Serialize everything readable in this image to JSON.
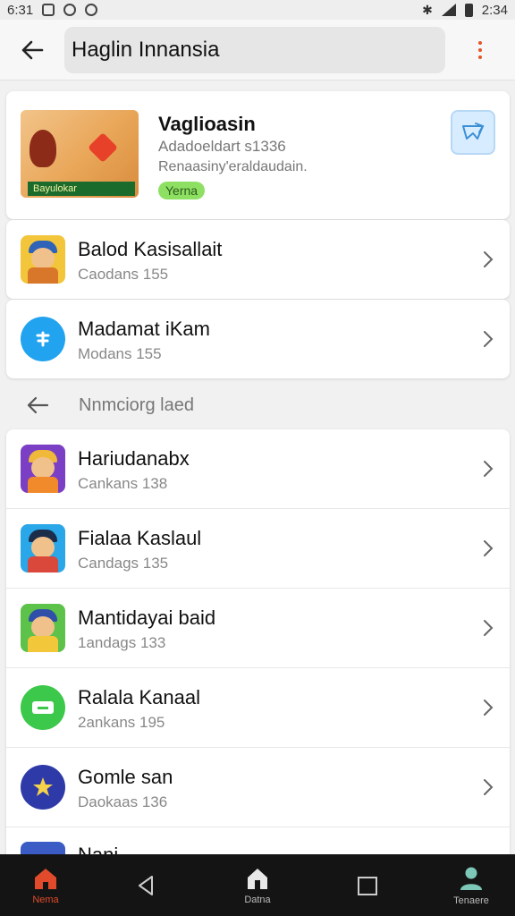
{
  "status_bar": {
    "time_left": "6:31",
    "time_right": "2:34"
  },
  "header": {
    "search_value": "Haglin Innansia",
    "back_icon": "arrow-left-icon",
    "menu_icon": "more-vert-icon"
  },
  "featured": {
    "title": "Vaglioasin",
    "subtitle": "Adadoeldart s1336",
    "description": "Renaasiny'eraldaudain.",
    "tag": "Yerna",
    "banner_text": "Bayulokar",
    "action_icon": "bookmark-arrow-icon",
    "colors": {
      "tag_bg": "#8ee063",
      "action_bg": "#d8ecff"
    }
  },
  "top_items": [
    {
      "title": "Balod Kasisallait",
      "subtitle": "Caodans 155",
      "icon": "game-avatar-icon"
    },
    {
      "title": "Madamat iKam",
      "subtitle": "Modans 155",
      "icon": "blue-circle-app-icon"
    }
  ],
  "section": {
    "label": "Nnmciorg laed"
  },
  "list_items": [
    {
      "title": "Hariudanabx",
      "subtitle": "Cankans 138",
      "icon": "game-avatar-icon"
    },
    {
      "title": "Fialaa Kaslaul",
      "subtitle": "Candags 135",
      "icon": "game-avatar-icon"
    },
    {
      "title": "Mantidayai baid",
      "subtitle": "1andags 133",
      "icon": "game-avatar-icon"
    },
    {
      "title": "Ralala Kanaal",
      "subtitle": "2ankans 195",
      "icon": "green-circle-app-icon"
    },
    {
      "title": "Gomle san",
      "subtitle": "Daokaas 136",
      "icon": "star-circle-app-icon"
    },
    {
      "title": "Nani",
      "subtitle": "",
      "icon": "app-icon"
    }
  ],
  "nav": [
    {
      "label": "Nema",
      "icon": "home-icon",
      "active": true
    },
    {
      "label": "",
      "icon": "back-triangle-icon",
      "active": false
    },
    {
      "label": "Datna",
      "icon": "home-outline-icon",
      "active": false
    },
    {
      "label": "",
      "icon": "recents-square-icon",
      "active": false
    },
    {
      "label": "Tenaere",
      "icon": "person-icon",
      "active": false
    }
  ],
  "colors": {
    "accent": "#e14b2b",
    "background": "#f1f1f1",
    "card": "#ffffff"
  }
}
